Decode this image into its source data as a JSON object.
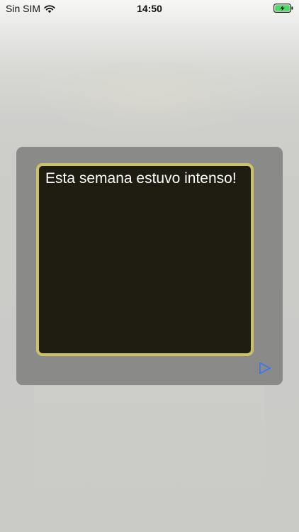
{
  "status_bar": {
    "carrier": "Sin SIM",
    "time": "14:50",
    "wifi_icon": "wifi-icon",
    "battery_icon": "battery-charging-icon",
    "battery_color": "#4cd964"
  },
  "message_panel": {
    "text": "Esta semana estuvo intenso!",
    "send_icon": "play-outline-icon",
    "accent_color": "#3478f6",
    "border_color": "#c9c26a",
    "text_bg_color": "#1f1d12"
  }
}
